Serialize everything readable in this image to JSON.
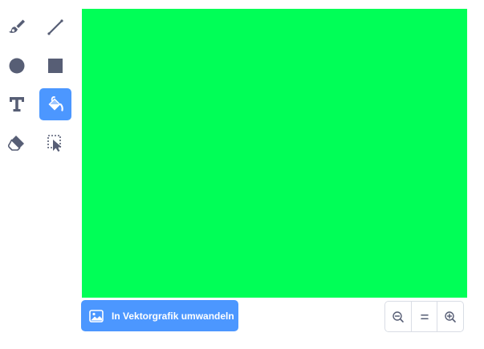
{
  "tools": [
    {
      "name": "brush",
      "icon": "brush-icon"
    },
    {
      "name": "line",
      "icon": "line-icon"
    },
    {
      "name": "circle",
      "icon": "circle-icon"
    },
    {
      "name": "rectangle",
      "icon": "rectangle-icon"
    },
    {
      "name": "text",
      "icon": "text-icon"
    },
    {
      "name": "fill",
      "icon": "fill-bucket-icon",
      "active": true
    },
    {
      "name": "eraser",
      "icon": "eraser-icon"
    },
    {
      "name": "select",
      "icon": "select-icon"
    }
  ],
  "colors": {
    "accent": "#4c97ff",
    "tool_icon": "#575e75",
    "canvas_fill": "#00ff57"
  },
  "convert_button": {
    "label": "In Vektorgrafik umwandeln",
    "icon": "image-icon"
  },
  "zoom": {
    "zoom_out_icon": "zoom-out-icon",
    "reset_icon": "zoom-reset-icon",
    "zoom_in_icon": "zoom-in-icon"
  }
}
